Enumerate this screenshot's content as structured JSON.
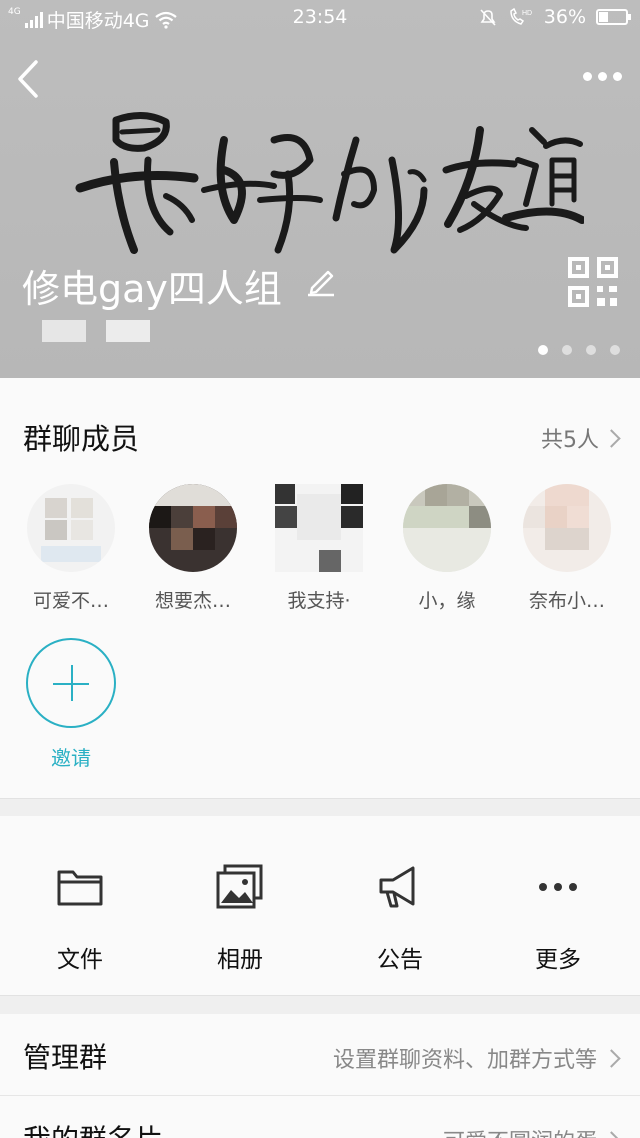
{
  "status_bar": {
    "network_small": "4G",
    "carrier": "中国移动4G",
    "time": "23:54",
    "battery": "36%",
    "battery_fraction": 0.36,
    "hd_label": "HD"
  },
  "header": {
    "cover_text": "最好的友谊",
    "group_name": "修电gay四人组",
    "page_dots": 4,
    "active_dot": 0
  },
  "members": {
    "title": "群聊成员",
    "count": "共5人",
    "list": [
      {
        "name": "可爱不…"
      },
      {
        "name": "想要杰…"
      },
      {
        "name": "我支持·"
      },
      {
        "name": "小，缘"
      },
      {
        "name": "奈布小…"
      }
    ],
    "invite_label": "邀请"
  },
  "actions": [
    {
      "label": "文件",
      "icon": "folder-icon"
    },
    {
      "label": "相册",
      "icon": "album-icon"
    },
    {
      "label": "公告",
      "icon": "megaphone-icon"
    },
    {
      "label": "更多",
      "icon": "more-icon"
    }
  ],
  "rows": {
    "manage": {
      "label": "管理群",
      "value": "设置群聊资料、加群方式等"
    },
    "my_card": {
      "label": "我的群名片",
      "value": "可爱不圆润的蛋"
    }
  },
  "colors": {
    "accent": "#2ab0c4",
    "cover_bg": "#bbbbbb"
  }
}
